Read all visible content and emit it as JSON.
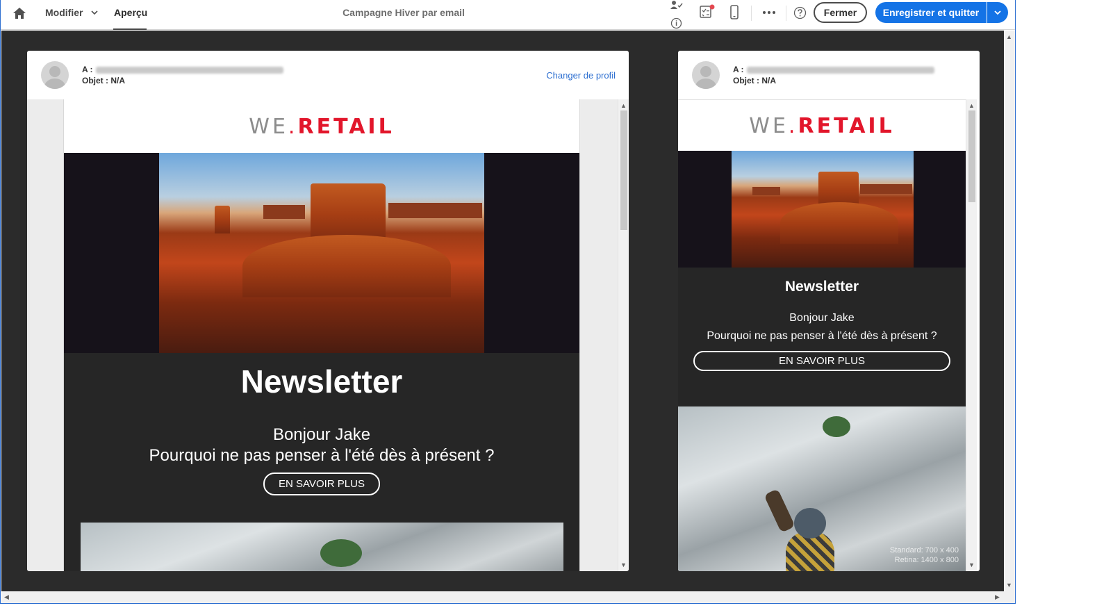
{
  "topbar": {
    "nav_modifier": "Modifier",
    "nav_apercu": "Aperçu",
    "title": "Campagne Hiver par email",
    "close_label": "Fermer",
    "save_label": "Enregistrer et quitter"
  },
  "preview_header": {
    "to_label": "A :",
    "subject_label": "Objet : N/A",
    "change_profile": "Changer de profil"
  },
  "email": {
    "logo_we": "WE",
    "logo_dot": ".",
    "logo_retail": "RETAIL",
    "newsletter_title": "Newsletter",
    "greeting": "Bonjour Jake",
    "body_text": "Pourquoi ne pas penser à l'été dès à présent ?",
    "cta_label": "EN SAVOIR PLUS",
    "image_watermark_line1": "Standard: 700 x 400",
    "image_watermark_line2": "Retina: 1400 x 800"
  },
  "colors": {
    "accent": "#1473e6",
    "brand_red": "#e2162b",
    "workspace_bg": "#2b2b2b"
  }
}
